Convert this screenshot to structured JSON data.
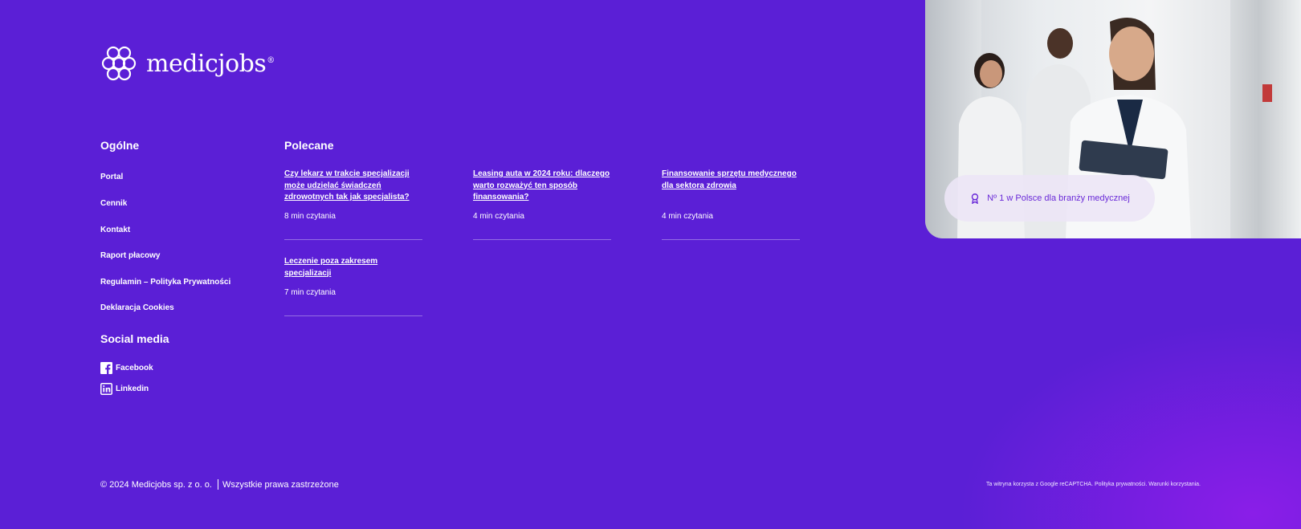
{
  "brand": {
    "name": "medicjobs",
    "registered": "®"
  },
  "general": {
    "title": "Ogólne",
    "links": [
      "Portal",
      "Cennik",
      "Kontakt",
      "Raport płacowy",
      "Regulamin – Polityka Prywatności",
      "Deklaracja Cookies"
    ]
  },
  "social": {
    "title": "Social media",
    "links": [
      {
        "label": "Facebook",
        "icon": "facebook-icon"
      },
      {
        "label": "Linkedin",
        "icon": "linkedin-icon"
      }
    ]
  },
  "recommended": {
    "title": "Polecane",
    "articles": [
      {
        "title": "Czy lekarz w trakcie specjalizacji może udzielać świadczeń zdrowotnych tak jak specjalista?",
        "time": "8 min czytania"
      },
      {
        "title": "Leasing auta w 2024 roku: dlaczego warto rozważyć ten sposób finansowania?",
        "time": "4 min czytania"
      },
      {
        "title": "Finansowanie sprzętu medycznego dla sektora zdrowia",
        "time": "4 min czytania"
      },
      {
        "title": "Leczenie poza zakresem specjalizacji",
        "time": "7 min czytania"
      }
    ]
  },
  "hero_badge": {
    "text": "Nº 1 w Polsce dla branży medycznej",
    "icon": "award-icon"
  },
  "footer": {
    "copyright": "© 2024 Medicjobs sp. z o. o.",
    "rights": "Wszystkie prawa zastrzeżone",
    "recaptcha": "Ta witryna korzysta z Google reCAPTCHA. Polityka prywatności. Warunki korzystania."
  },
  "colors": {
    "background": "#5b1fd6",
    "accent_glow": "#8a1ee8",
    "badge_text": "#6a2ad8"
  }
}
